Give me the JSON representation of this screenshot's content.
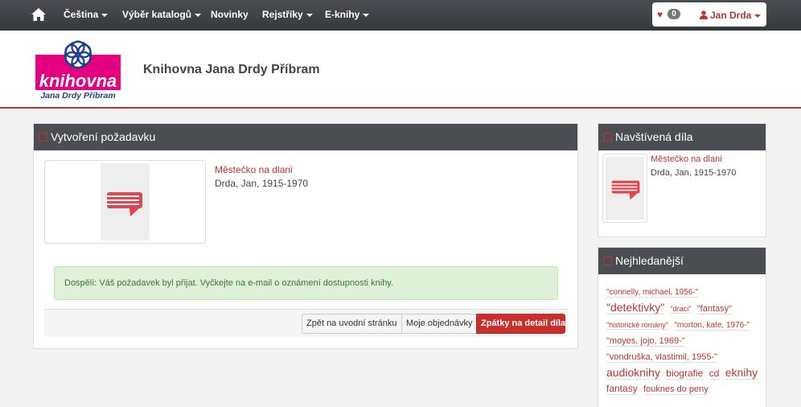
{
  "navbar": {
    "items": [
      {
        "label": "Čeština",
        "dropdown": true
      },
      {
        "label": "Výběr katalogů",
        "dropdown": true
      },
      {
        "label": "Novinky",
        "dropdown": false
      },
      {
        "label": "Rejstříky",
        "dropdown": true
      },
      {
        "label": "E-knihy",
        "dropdown": true
      }
    ],
    "favorites_count": "0",
    "user_name": "Jan Drda"
  },
  "header": {
    "logo_text": "knihovna",
    "logo_subtext": "Jana Drdy Příbram",
    "site_title": "Knihovna Jana Drdy Příbram"
  },
  "main": {
    "heading": "Vytvoření požadavku",
    "book": {
      "title": "Městečko na dlani",
      "author": "Drda, Jan, 1915-1970"
    },
    "alert": "Dospělí: Váš požadavek byl přijat. Vyčkejte na e-mail o oznámení dostupnosti knihy.",
    "buttons": {
      "back": "Zpět na uvodní stránku",
      "orders": "Moje objednávky",
      "detail": "Zpátky na detail díla"
    }
  },
  "visited": {
    "heading": "Navštívená díla",
    "book": {
      "title": "Městečko na dlani",
      "author": "Drda, Jan, 1915-1970"
    }
  },
  "popular": {
    "heading": "Nejhledanější",
    "tags": [
      {
        "label": "\"connelly, michael, 1956-\"",
        "size": 2
      },
      {
        "label": "\"detektivky\"",
        "size": 5
      },
      {
        "label": "\"draci\"",
        "size": 1
      },
      {
        "label": "\"fantasy\"",
        "size": 3
      },
      {
        "label": "\"historické romány\"",
        "size": 1
      },
      {
        "label": "\"morton, kate, 1976-\"",
        "size": 2
      },
      {
        "label": "\"moyes, jojo, 1969-\"",
        "size": 3
      },
      {
        "label": "\"vondruška, vlastimil, 1955-\"",
        "size": 3
      },
      {
        "label": "audioknihy",
        "size": 5
      },
      {
        "label": "biografie",
        "size": 4
      },
      {
        "label": "cd",
        "size": 4
      },
      {
        "label": "eknihy",
        "size": 5
      },
      {
        "label": "fantasy",
        "size": 4
      },
      {
        "label": "fouknes do peny",
        "size": 3
      }
    ]
  },
  "colors": {
    "accent": "#c9302c",
    "navbar": "#3d4044",
    "success_bg": "#dff0d8"
  }
}
